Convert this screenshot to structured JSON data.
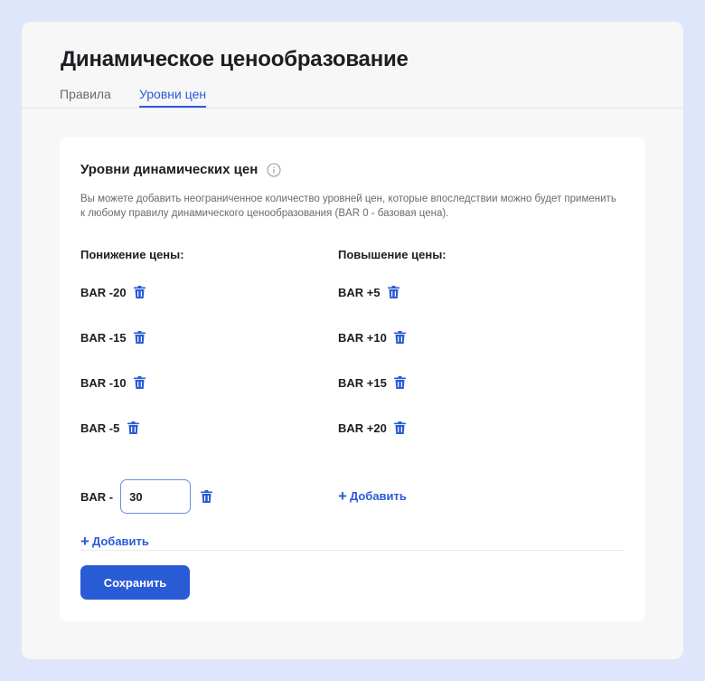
{
  "header": {
    "title": "Динамическое ценообразование"
  },
  "tabs": [
    {
      "label": "Правила",
      "active": false
    },
    {
      "label": "Уровни цен",
      "active": true
    }
  ],
  "card": {
    "title": "Уровни динамических цен",
    "description": "Вы можете добавить неограниченное количество уровней цен, которые впоследствии можно будет применить к любому правилу динамического ценообразования (BAR 0 - базовая цена).",
    "decrease": {
      "heading": "Понижение цены:",
      "levels": [
        "BAR -20",
        "BAR -15",
        "BAR -10",
        "BAR -5"
      ],
      "new_prefix": "BAR -",
      "new_value": "30",
      "add_label": "Добавить"
    },
    "increase": {
      "heading": "Повышение цены:",
      "levels": [
        "BAR +5",
        "BAR +10",
        "BAR +15",
        "BAR +20"
      ],
      "add_label": "Добавить"
    },
    "save_label": "Сохранить"
  },
  "icons": {
    "info": "info-circle-icon",
    "delete": "trash-icon",
    "add": "plus-icon"
  },
  "colors": {
    "accent": "#2a5bd7",
    "page_bg": "#dfe6fb",
    "panel_bg": "#f7f7f8",
    "card_bg": "#ffffff"
  }
}
